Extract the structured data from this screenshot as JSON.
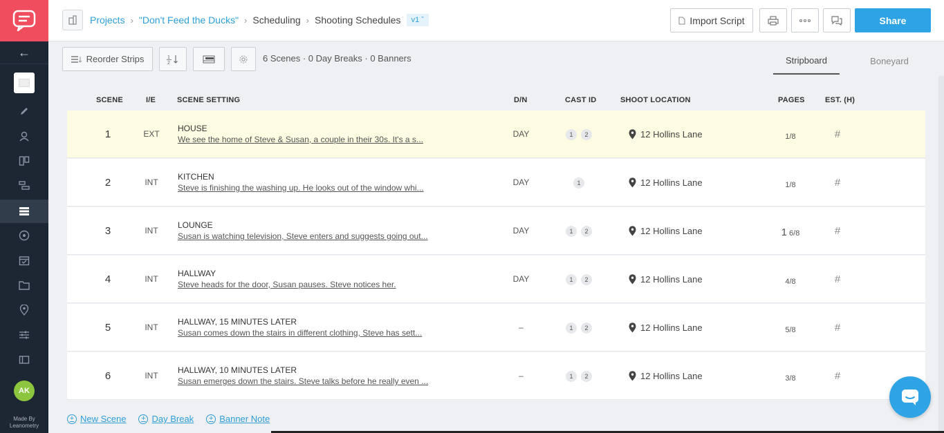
{
  "sidebar": {
    "back_icon": "arrow-left-icon",
    "avatar_initials": "AK",
    "made_by": "Made By",
    "made_by_company": "Leanometry",
    "items": [
      {
        "icon": "pencil-icon"
      },
      {
        "icon": "characters-icon"
      },
      {
        "icon": "storyboard-icon"
      },
      {
        "icon": "shot-list-icon"
      },
      {
        "icon": "stripboard-icon",
        "active": true
      },
      {
        "icon": "elements-icon"
      },
      {
        "icon": "calendar-icon"
      },
      {
        "icon": "folder-icon"
      },
      {
        "icon": "location-pin-icon"
      },
      {
        "icon": "sliders-icon"
      },
      {
        "icon": "budget-icon"
      }
    ]
  },
  "header": {
    "breadcrumb": {
      "projects": "Projects",
      "project": "\"Don't Feed the Ducks\"",
      "section": "Scheduling",
      "page": "Shooting Schedules",
      "version": "v1"
    },
    "import_label": "Import Script",
    "share_label": "Share"
  },
  "toolbar": {
    "reorder_label": "Reorder Strips",
    "counts": "6 Scenes · 0 Day Breaks · 0 Banners",
    "tabs": [
      "Stripboard",
      "Boneyard"
    ]
  },
  "table": {
    "headers": {
      "scene": "SCENE",
      "ie": "I/E",
      "setting": "SCENE SETTING",
      "dn": "D/N",
      "cast": "CAST ID",
      "location": "SHOOT LOCATION",
      "pages": "PAGES",
      "est": "EST. (H)"
    },
    "rows": [
      {
        "scene": "1",
        "ie": "EXT",
        "title": "HOUSE",
        "desc": "We see the home of Steve & Susan, a couple in their 30s. It's a s...",
        "dn": "DAY",
        "cast": [
          "1",
          "2"
        ],
        "location": "12 Hollins Lane",
        "pages_whole": "",
        "pages_frac": "1/8",
        "est": "#"
      },
      {
        "scene": "2",
        "ie": "INT",
        "title": "KITCHEN",
        "desc": "Steve is finishing the washing up. He looks out of the window whi...",
        "dn": "DAY",
        "cast": [
          "1"
        ],
        "location": "12 Hollins Lane",
        "pages_whole": "",
        "pages_frac": "1/8",
        "est": "#"
      },
      {
        "scene": "3",
        "ie": "INT",
        "title": "LOUNGE",
        "desc": "Susan is watching television, Steve enters and suggests going out...",
        "dn": "DAY",
        "cast": [
          "1",
          "2"
        ],
        "location": "12 Hollins Lane",
        "pages_whole": "1",
        "pages_frac": "6/8",
        "est": "#"
      },
      {
        "scene": "4",
        "ie": "INT",
        "title": "HALLWAY",
        "desc": "Steve heads for the door, Susan pauses. Steve notices her.",
        "dn": "DAY",
        "cast": [
          "1",
          "2"
        ],
        "location": "12 Hollins Lane",
        "pages_whole": "",
        "pages_frac": "4/8",
        "est": "#"
      },
      {
        "scene": "5",
        "ie": "INT",
        "title": "HALLWAY, 15 MINUTES LATER",
        "desc": "Susan comes down the stairs in different clothing, Steve has sett...",
        "dn": "–",
        "cast": [
          "1",
          "2"
        ],
        "location": "12 Hollins Lane",
        "pages_whole": "",
        "pages_frac": "5/8",
        "est": "#"
      },
      {
        "scene": "6",
        "ie": "INT",
        "title": "HALLWAY, 10 MINUTES LATER",
        "desc": "Susan emerges down the stairs. Steve talks before he really even ...",
        "dn": "–",
        "cast": [
          "1",
          "2"
        ],
        "location": "12 Hollins Lane",
        "pages_whole": "",
        "pages_frac": "3/8",
        "est": "#"
      }
    ]
  },
  "footer": {
    "new_scene": "New Scene",
    "day_break": "Day Break",
    "banner_note": "Banner Note"
  },
  "colors": {
    "accent": "#2ea3e6",
    "logo": "#f04e5e",
    "sidebar": "#1d2633",
    "highlight_row": "#fdfbe2",
    "avatar": "#8cc63e"
  }
}
